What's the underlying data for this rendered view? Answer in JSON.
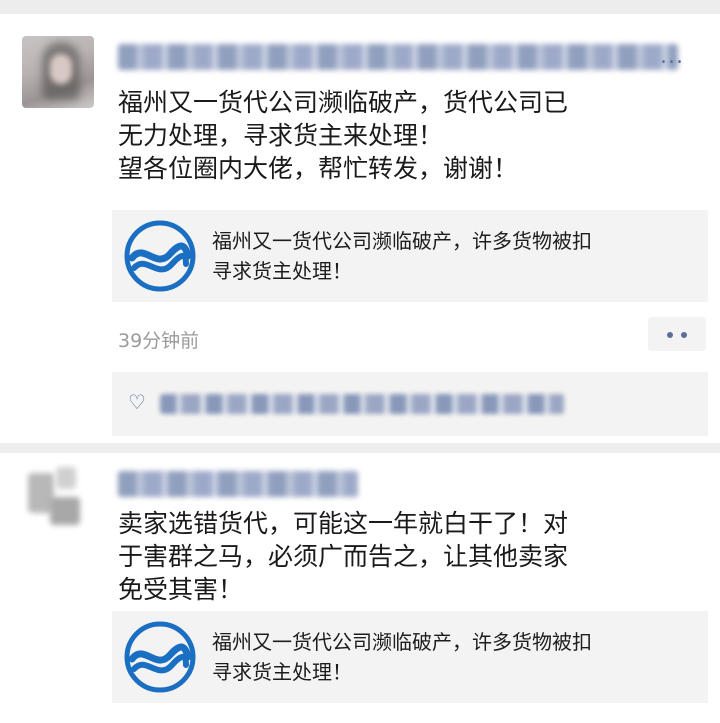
{
  "posts": [
    {
      "content_lines": [
        "福州又一货代公司濒临破产，货代公司已",
        "无力处理，寻求货主来处理！",
        "望各位圈内大佬，帮忙转发，谢谢！"
      ],
      "link_card": {
        "line1": "福州又一货代公司濒临破产，许多货物被扣",
        "line2": "寻求货主处理！"
      },
      "time": "39分钟前",
      "name_ellipsis": "..."
    },
    {
      "content_lines": [
        "卖家选错货代，可能这一年就白干了！对",
        "于害群之马，必须广而告之，让其他卖家",
        "免受其害！"
      ],
      "link_card": {
        "line1": "福州又一货代公司濒临破产，许多货物被扣",
        "line2": "寻求货主处理！"
      }
    }
  ],
  "colors": {
    "link_blue": "#5b6f9a",
    "card_bg": "#f3f3f3",
    "divider": "#ededed",
    "logo_blue": "#1b6fc2",
    "time_gray": "#9a9a9a"
  },
  "icons": [
    "heart-icon",
    "more-dots-icon",
    "company-logo-icon"
  ]
}
